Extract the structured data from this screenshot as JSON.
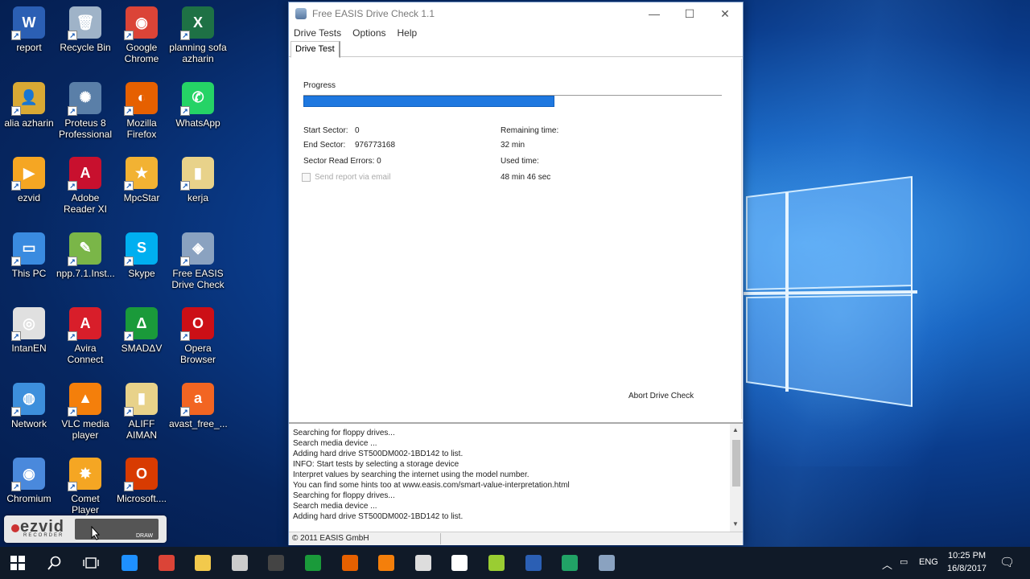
{
  "desktop": {
    "icons": [
      {
        "label": "report",
        "color": "#2b5fb4",
        "glyph": "W"
      },
      {
        "label": "Recycle Bin",
        "color": "#9fb3c8",
        "glyph": "🗑"
      },
      {
        "label": "Google Chrome",
        "color": "#db4437",
        "glyph": "◉"
      },
      {
        "label": "planning sofa azharin",
        "color": "#1e7145",
        "glyph": "X"
      },
      {
        "label": "alia azharin",
        "color": "#d9a934",
        "glyph": "👤"
      },
      {
        "label": "Proteus 8 Professional",
        "color": "#5a7fa8",
        "glyph": "✺"
      },
      {
        "label": "Mozilla Firefox",
        "color": "#e66000",
        "glyph": "◐"
      },
      {
        "label": "WhatsApp",
        "color": "#25d366",
        "glyph": "✆"
      },
      {
        "label": "ezvid",
        "color": "#f5a623",
        "glyph": "▶"
      },
      {
        "label": "Adobe Reader XI",
        "color": "#c8102e",
        "glyph": "A"
      },
      {
        "label": "MpcStar",
        "color": "#f2b233",
        "glyph": "★"
      },
      {
        "label": "kerja",
        "color": "#e8d28a",
        "glyph": "▮"
      },
      {
        "label": "This PC",
        "color": "#3a8be0",
        "glyph": "▭"
      },
      {
        "label": "npp.7.1.Inst...",
        "color": "#7ab648",
        "glyph": "✎"
      },
      {
        "label": "Skype",
        "color": "#00aff0",
        "glyph": "S"
      },
      {
        "label": "Free EASIS Drive Check",
        "color": "#8aa2c0",
        "glyph": "◈"
      },
      {
        "label": "IntanEN",
        "color": "#e0e0e0",
        "glyph": "◎"
      },
      {
        "label": "Avira Connect",
        "color": "#d81e2a",
        "glyph": "A"
      },
      {
        "label": "SMADΔV",
        "color": "#1a9a3a",
        "glyph": "Δ"
      },
      {
        "label": "Opera Browser",
        "color": "#cc0f16",
        "glyph": "O"
      },
      {
        "label": "Network",
        "color": "#3d8fdc",
        "glyph": "◍"
      },
      {
        "label": "VLC media player",
        "color": "#f47f0b",
        "glyph": "▲"
      },
      {
        "label": "ALIFF AIMAN",
        "color": "#e8d28a",
        "glyph": "▮"
      },
      {
        "label": "avast_free_...",
        "color": "#f26522",
        "glyph": "a"
      },
      {
        "label": "Chromium",
        "color": "#4a89dc",
        "glyph": "◉"
      },
      {
        "label": "Comet Player",
        "color": "#f5a623",
        "glyph": "✸"
      },
      {
        "label": "Microsoft....",
        "color": "#d83b01",
        "glyph": "O"
      }
    ]
  },
  "app": {
    "title": "Free EASIS Drive Check 1.1",
    "menu": [
      "Drive Tests",
      "Options",
      "Help"
    ],
    "tab": "Drive Test",
    "progress_label": "Progress",
    "progress_fraction": 0.6,
    "start_sector_label": "Start Sector:",
    "start_sector_value": "0",
    "end_sector_label": "End Sector:",
    "end_sector_value": "976773168",
    "sector_read_errors": "Sector Read Errors: 0",
    "send_report": "Send report via email",
    "remaining_time_label": "Remaining time:",
    "remaining_time_value": "32 min",
    "used_time_label": "Used time:",
    "used_time_value": "48 min 46 sec",
    "abort_button": "Abort Drive Check",
    "log": [
      "Searching for floppy drives...",
      "Search media device ...",
      "Adding hard drive ST500DM002-1BD142 to list.",
      "INFO: Start tests by selecting a storage device",
      "Interpret values by searching the internet using the model number.",
      "You can find some hints too at www.easis.com/smart-value-interpretation.html",
      "Searching for floppy drives...",
      "Search media device ...",
      "Adding hard drive ST500DM002-1BD142 to list."
    ],
    "status": "© 2011 EASIS GmbH"
  },
  "ezvid": {
    "logo": "ezvid",
    "sub": "RECORDER",
    "draw": "DRAW"
  },
  "taskbar": {
    "items": [
      "start-button",
      "search-button",
      "task-view-button",
      "edge",
      "chrome",
      "file-explorer",
      "store",
      "terminal",
      "smadav",
      "firefox",
      "xampp",
      "app-bird",
      "mail",
      "notepad",
      "word",
      "sheets",
      "easis"
    ],
    "tray": {
      "language": "ENG",
      "time": "10:25 PM",
      "date": "16/8/2017"
    }
  }
}
